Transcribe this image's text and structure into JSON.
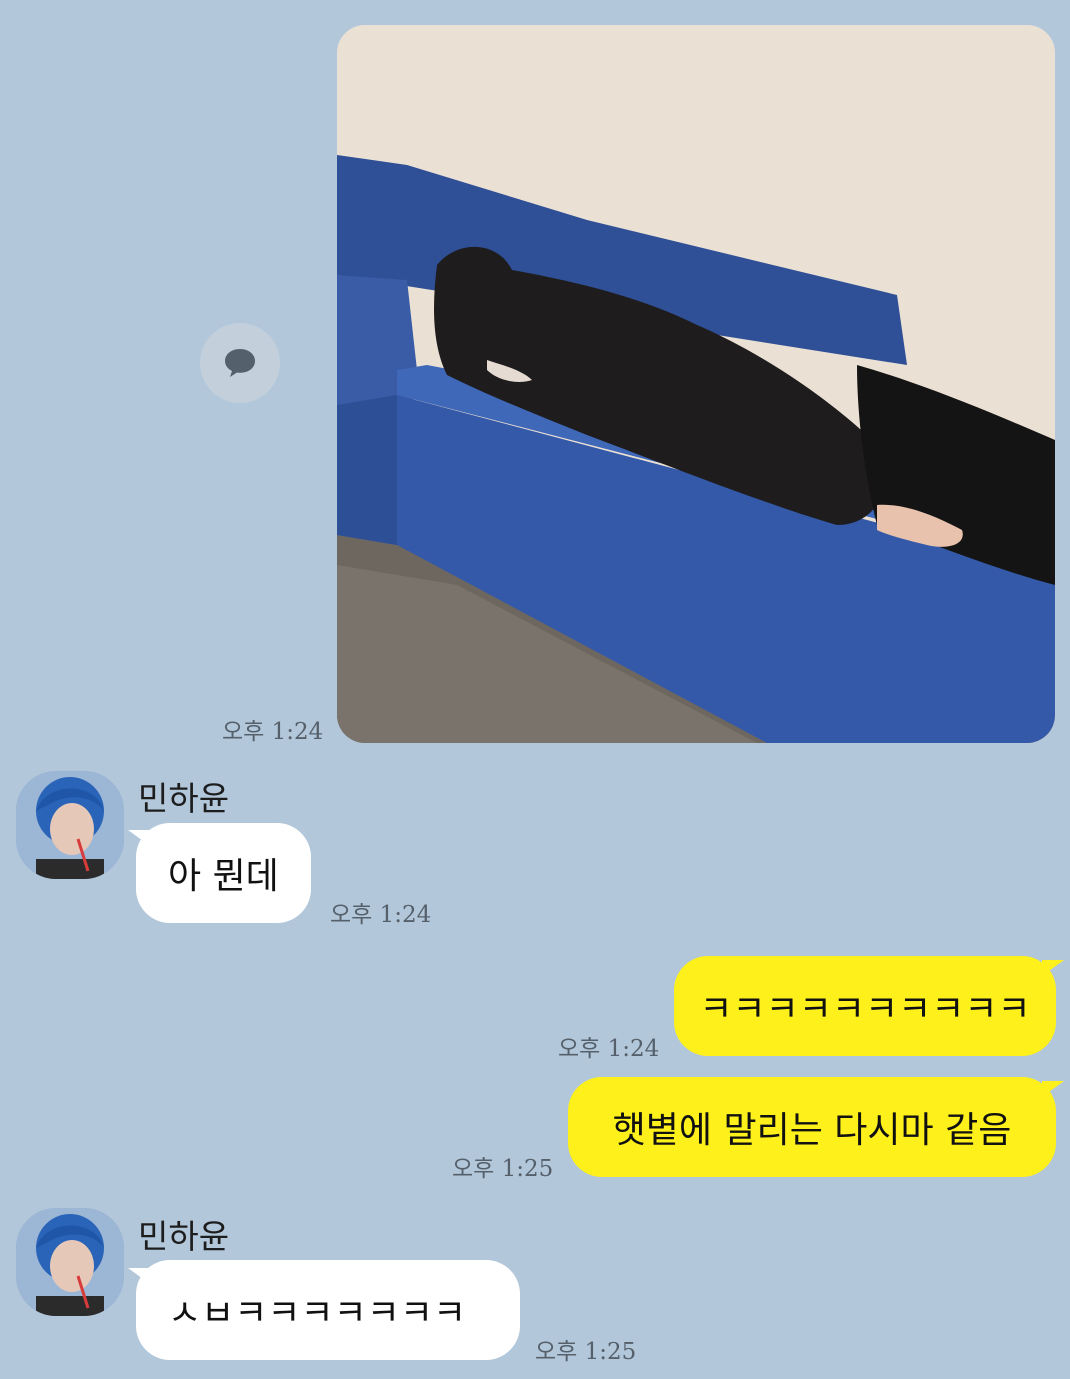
{
  "chat": {
    "messages": [
      {
        "id": "m1",
        "sender": "me",
        "type": "photo",
        "time": "오후 1:24"
      },
      {
        "id": "m2",
        "sender": "민하윤",
        "type": "text",
        "text": "아 뭔데",
        "time": "오후 1:24"
      },
      {
        "id": "m3",
        "sender": "me",
        "type": "text",
        "text": "ㅋㅋㅋㅋㅋㅋㅋㅋㅋㅋ",
        "time": "오후 1:24"
      },
      {
        "id": "m4",
        "sender": "me",
        "type": "text",
        "text": "햇볕에 말리는 다시마 같음",
        "time": "오후 1:25"
      },
      {
        "id": "m5",
        "sender": "민하윤",
        "type": "text",
        "text": "ㅅㅂㅋㅋㅋㅋㅋㅋㅋ",
        "time": "오후 1:25"
      }
    ],
    "contact": {
      "name": "민하윤"
    }
  },
  "colors": {
    "background": "#b2c7da",
    "my_bubble": "#fef01b",
    "their_bubble": "#ffffff",
    "time_text": "#55606b"
  },
  "icons": {
    "share": "chat-bubble-icon"
  }
}
